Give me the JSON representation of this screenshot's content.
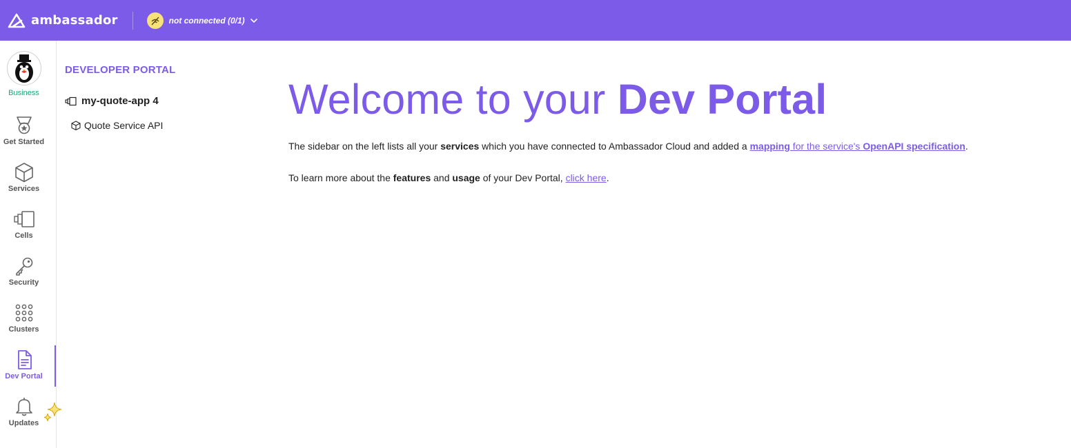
{
  "topbar": {
    "brand": "ambassador",
    "connection_status": "not connected",
    "connection_count": "(0/1)",
    "bg_color": "#7c5be8",
    "status_icon": "disconnected-icon",
    "dropdown_icon": "chevron-down-icon"
  },
  "rail": {
    "plan": "Business",
    "avatar_icon": "penguin-mascot-icon",
    "items": [
      {
        "label": "Get Started",
        "icon": "medal-icon"
      },
      {
        "label": "Services",
        "icon": "cube-icon"
      },
      {
        "label": "Cells",
        "icon": "cells-icon"
      },
      {
        "label": "Security",
        "icon": "key-icon"
      },
      {
        "label": "Clusters",
        "icon": "grid-dots-icon"
      },
      {
        "label": "Dev Portal",
        "icon": "document-icon",
        "active": true
      },
      {
        "label": "Updates",
        "icon": "bell-icon"
      }
    ],
    "accent_color": "#7c5be8"
  },
  "sidebar": {
    "title": "DEVELOPER PORTAL",
    "app": {
      "name": "my-quote-app 4",
      "icon": "cells-icon"
    },
    "services": [
      {
        "name": "Quote Service API",
        "icon": "cube-icon"
      }
    ]
  },
  "main": {
    "headline_light": "Welcome to your ",
    "headline_bold": "Dev Portal",
    "p1": {
      "t1": "The sidebar on the left lists all your ",
      "b1": "services",
      "t2": " which you have connected to Ambassador Cloud and added a ",
      "link_b1": "mapping",
      "link_t1": " for the service's ",
      "link_b2": "OpenAPI specification",
      "t3": "."
    },
    "p2": {
      "t1": "To learn more about the ",
      "b1": "features",
      "t2": " and ",
      "b2": "usage",
      "t3": " of your Dev Portal, ",
      "link": "click here",
      "t4": "."
    }
  }
}
